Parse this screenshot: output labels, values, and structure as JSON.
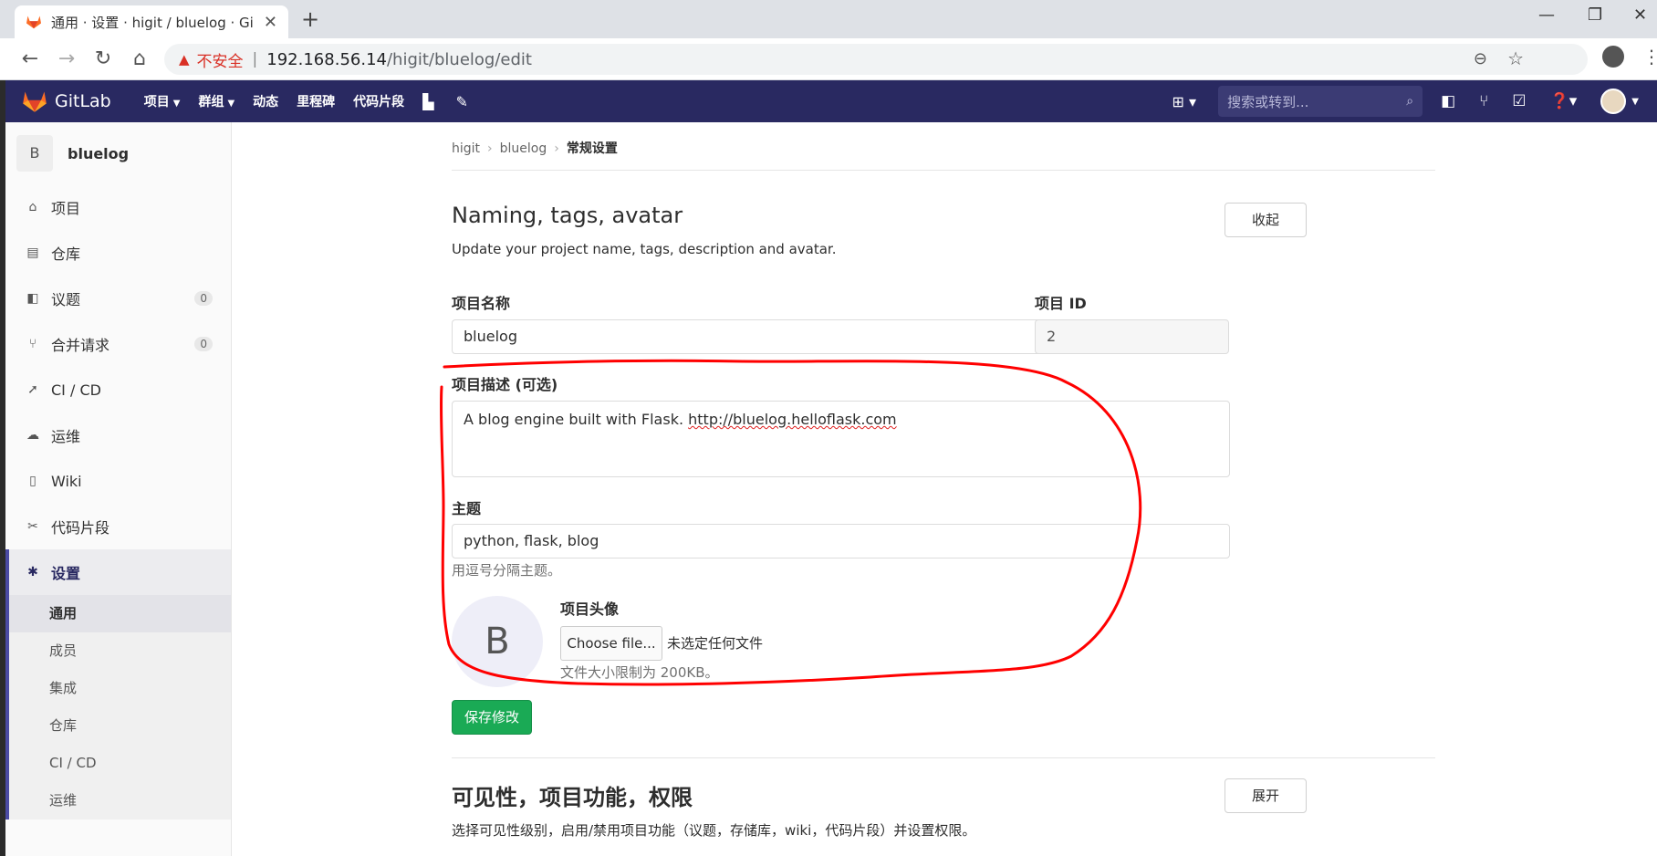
{
  "browser": {
    "tab_title": "通用 · 设置 · higit / bluelog · Gi",
    "new_tab": "+",
    "insecure_label": "不安全",
    "url_host": "192.168.56.14",
    "url_path": "/higit/bluelog/edit"
  },
  "navbar": {
    "brand": "GitLab",
    "menu": [
      "项目",
      "群组",
      "动态",
      "里程碑",
      "代码片段"
    ],
    "search_placeholder": "搜索或转到..."
  },
  "sidebar": {
    "project_avatar_letter": "B",
    "project_name": "bluelog",
    "items": [
      {
        "label": "项目",
        "icon": "home-icon"
      },
      {
        "label": "仓库",
        "icon": "repository-icon"
      },
      {
        "label": "议题",
        "icon": "issues-icon",
        "count": "0"
      },
      {
        "label": "合并请求",
        "icon": "merge-request-icon",
        "count": "0"
      },
      {
        "label": "CI / CD",
        "icon": "rocket-icon"
      },
      {
        "label": "运维",
        "icon": "cloud-gear-icon"
      },
      {
        "label": "Wiki",
        "icon": "book-icon"
      },
      {
        "label": "代码片段",
        "icon": "scissors-icon"
      },
      {
        "label": "设置",
        "icon": "gear-icon"
      }
    ],
    "settings_sub": [
      "通用",
      "成员",
      "集成",
      "仓库",
      "CI / CD",
      "运维"
    ]
  },
  "breadcrumb": [
    "higit",
    "bluelog",
    "常规设置"
  ],
  "naming_section": {
    "title": "Naming, tags, avatar",
    "description": "Update your project name, tags, description and avatar.",
    "collapse_label": "收起",
    "name_label": "项目名称",
    "name_value": "bluelog",
    "id_label": "项目 ID",
    "id_value": "2",
    "desc_label": "项目描述 (可选)",
    "desc_value_prefix": "A blog engine built with Flask. ",
    "desc_value_url": "http://bluelog.helloflask.com",
    "topics_label": "主题",
    "topics_value": "python, flask, blog",
    "topics_hint": "用逗号分隔主题。",
    "avatar_label": "项目头像",
    "avatar_letter": "B",
    "choose_file": "Choose file...",
    "no_file": "未选定任何文件",
    "size_hint": "文件大小限制为 200KB。",
    "save_label": "保存修改"
  },
  "visibility_section": {
    "title": "可见性，项目功能，权限",
    "description": "选择可见性级别，启用/禁用项目功能（议题，存储库，wiki，代码片段）并设置权限。",
    "expand_label": "展开"
  },
  "colors": {
    "navbar_bg": "#292961",
    "save_green": "#1aaa55",
    "annotation_red": "#ff0000",
    "insecure_red": "#d93025"
  }
}
